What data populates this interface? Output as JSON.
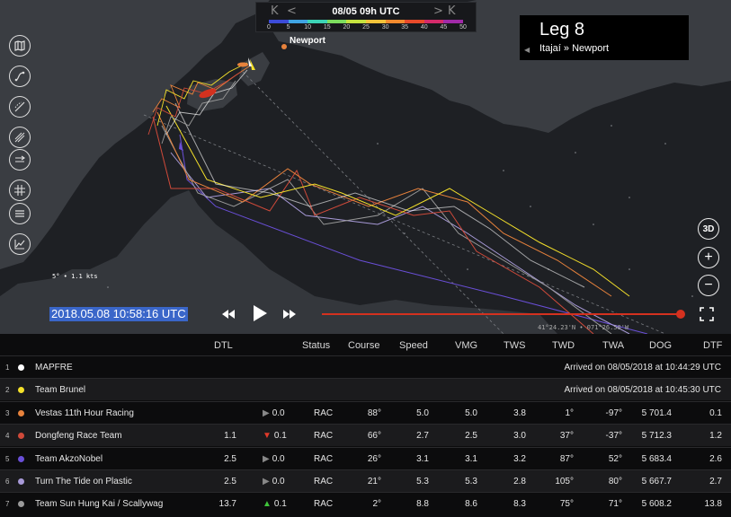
{
  "timeline": {
    "date": "08/05 09h UTC",
    "first": "K",
    "prev": "<",
    "next": ">",
    "last": "K"
  },
  "wind_scale": {
    "ticks": [
      "0",
      "5",
      "10",
      "15",
      "20",
      "25",
      "30",
      "35",
      "40",
      "45",
      "50"
    ],
    "colors": [
      "#3c4bd8",
      "#3fa3e2",
      "#3cd3b6",
      "#7cdd5e",
      "#c5e23f",
      "#f2c33a",
      "#f28a2e",
      "#e84a2a",
      "#d42a6a",
      "#a02aa8"
    ]
  },
  "leg": {
    "title": "Leg 8",
    "route": "Itajaí » Newport"
  },
  "map": {
    "place": "Newport",
    "wind_readout": "5° • 1.1 kts",
    "coords": "41°24.23'N • 071°26.50'W"
  },
  "controls": {
    "view_3d": "3D",
    "zoom_in": "+",
    "zoom_out": "−"
  },
  "playback": {
    "timestamp": "2018.05.08 10:58:16 UTC",
    "progress": 1.0
  },
  "table": {
    "headers": {
      "dtl": "DTL",
      "status": "Status",
      "course": "Course",
      "speed": "Speed",
      "vmg": "VMG",
      "tws": "TWS",
      "twd": "TWD",
      "twa": "TWA",
      "dog": "DOG",
      "dtf": "DTF"
    },
    "rows": [
      {
        "rank": "1",
        "color": "#ffffff",
        "name": "MAPFRE",
        "arrived": "Arrived on 08/05/2018 at 10:44:29 UTC"
      },
      {
        "rank": "2",
        "color": "#f5e12a",
        "name": "Team Brunel",
        "arrived": "Arrived on 08/05/2018 at 10:45:30 UTC"
      },
      {
        "rank": "3",
        "color": "#e8823c",
        "name": "Vestas 11th Hour Racing",
        "dtl": "",
        "trend": "▶",
        "trend_color": "#888888",
        "delta": "0.0",
        "status": "RAC",
        "course": "88°",
        "speed": "5.0",
        "vmg": "5.0",
        "tws": "3.8",
        "twd": "1°",
        "twa": "-97°",
        "dog": "5 701.4",
        "dtf": "0.1"
      },
      {
        "rank": "4",
        "color": "#d04a3a",
        "name": "Dongfeng Race Team",
        "dtl": "1.1",
        "trend": "▼",
        "trend_color": "#e23a2a",
        "delta": "0.1",
        "status": "RAC",
        "course": "66°",
        "speed": "2.7",
        "vmg": "2.5",
        "tws": "3.0",
        "twd": "37°",
        "twa": "-37°",
        "dog": "5 712.3",
        "dtf": "1.2"
      },
      {
        "rank": "5",
        "color": "#6a4fd8",
        "name": "Team AkzoNobel",
        "dtl": "2.5",
        "trend": "▶",
        "trend_color": "#888888",
        "delta": "0.0",
        "status": "RAC",
        "course": "26°",
        "speed": "3.1",
        "vmg": "3.1",
        "tws": "3.2",
        "twd": "87°",
        "twa": "52°",
        "dog": "5 683.4",
        "dtf": "2.6"
      },
      {
        "rank": "6",
        "color": "#a89ad8",
        "name": "Turn The Tide on Plastic",
        "dtl": "2.5",
        "trend": "▶",
        "trend_color": "#888888",
        "delta": "0.0",
        "status": "RAC",
        "course": "21°",
        "speed": "5.3",
        "vmg": "5.3",
        "tws": "2.8",
        "twd": "105°",
        "twa": "80°",
        "dog": "5 667.7",
        "dtf": "2.7"
      },
      {
        "rank": "7",
        "color": "#9a9a9a",
        "name": "Team Sun Hung Kai / Scallywag",
        "dtl": "13.7",
        "trend": "▲",
        "trend_color": "#3fc43a",
        "delta": "0.1",
        "status": "RAC",
        "course": "2°",
        "speed": "8.8",
        "vmg": "8.6",
        "tws": "8.3",
        "twd": "75°",
        "twa": "71°",
        "dog": "5 608.2",
        "dtf": "13.8"
      }
    ]
  }
}
